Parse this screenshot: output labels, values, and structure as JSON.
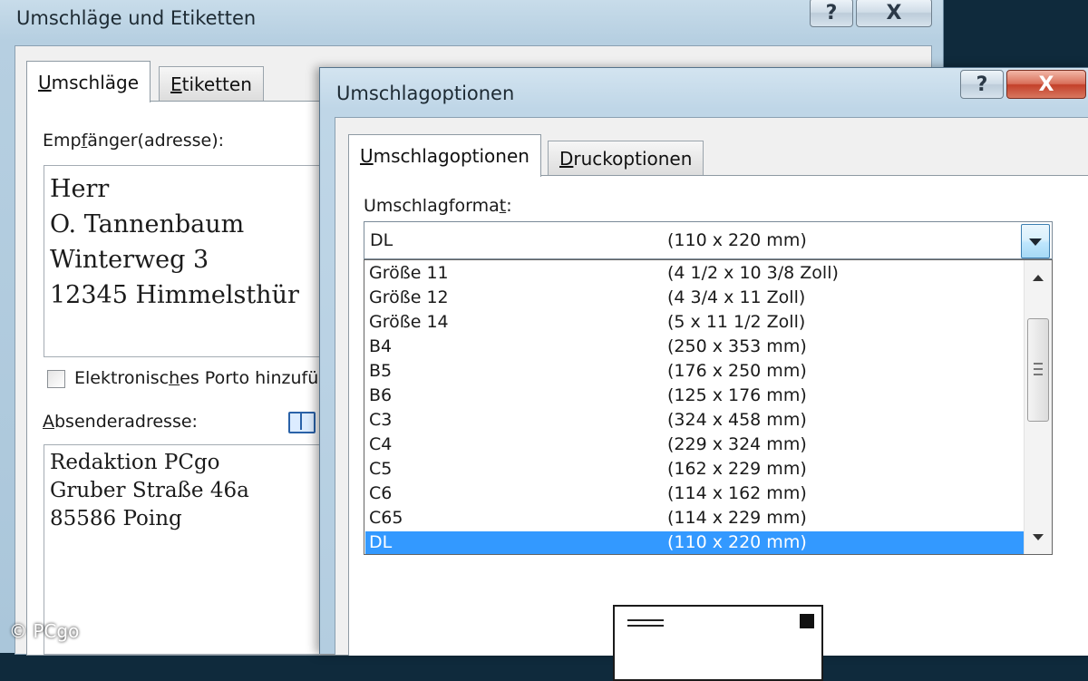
{
  "window_main": {
    "title": "Umschläge und Etiketten",
    "help_button": "?",
    "close_button": "X",
    "tabs": [
      {
        "label": "Umschläge",
        "underline": "U",
        "rest": "mschläge"
      },
      {
        "label": "Etiketten",
        "underline": "E",
        "rest": "tiketten"
      }
    ],
    "recipient": {
      "label_pre": "Emp",
      "label_u": "f",
      "label_post": "änger(adresse):",
      "lines": [
        "Herr",
        "O. Tannenbaum",
        "Winterweg 3",
        "12345  Himmelsthür"
      ]
    },
    "porto": {
      "label_pre": "Elektronisc",
      "label_u": "h",
      "label_post": "es Porto hinzufü"
    },
    "sender": {
      "label_pre": "",
      "label_u": "A",
      "label_post": "bsenderadresse:",
      "lines": [
        "Redaktion PCgo",
        "Gruber Straße 46a",
        "85586 Poing"
      ]
    }
  },
  "window_options": {
    "title": "Umschlagoptionen",
    "help_button": "?",
    "close_button": "X",
    "tabs": [
      {
        "label": "Umschlagoptionen",
        "underline": "U",
        "rest": "mschlagoptionen"
      },
      {
        "label": "Druckoptionen",
        "underline": "D",
        "rest": "ruckoptionen"
      }
    ],
    "format_label_pre": "Umschlagforma",
    "format_label_u": "t",
    "format_label_post": ":",
    "selected": {
      "name": "DL",
      "size": "(110 x 220 mm)"
    },
    "options": [
      {
        "name": "Größe 11",
        "size": "(4 1/2 x 10 3/8 Zoll)"
      },
      {
        "name": "Größe 12",
        "size": "(4 3/4 x 11 Zoll)"
      },
      {
        "name": "Größe 14",
        "size": "(5 x 11 1/2 Zoll)"
      },
      {
        "name": "B4",
        "size": "(250 x 353 mm)"
      },
      {
        "name": "B5",
        "size": "(176 x 250 mm)"
      },
      {
        "name": "B6",
        "size": "(125 x 176 mm)"
      },
      {
        "name": "C3",
        "size": "(324 x 458 mm)"
      },
      {
        "name": "C4",
        "size": "(229 x 324 mm)"
      },
      {
        "name": "C5",
        "size": "(162 x 229 mm)"
      },
      {
        "name": "C6",
        "size": "(114 x 162 mm)"
      },
      {
        "name": "C65",
        "size": "(114 x 229 mm)"
      },
      {
        "name": "DL",
        "size": "(110 x 220 mm)"
      }
    ]
  },
  "watermark": "© PCgo",
  "colors": {
    "selection": "#3399ff",
    "close_red": "#c3402a"
  }
}
